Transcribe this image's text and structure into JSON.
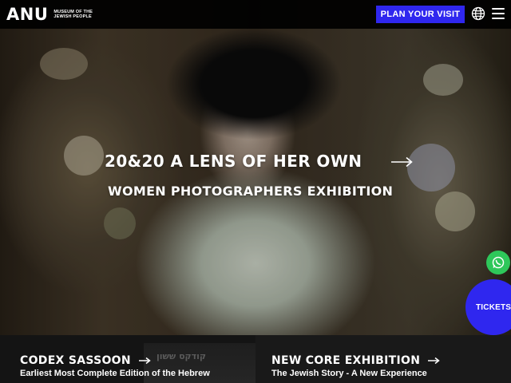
{
  "header": {
    "logo_text": "ANU",
    "logo_subtitle": "Museum of the Jewish People",
    "plan_visit_label": "PLAN YOUR VISIT",
    "language_icon": "globe-icon",
    "menu_icon": "hamburger-menu-icon"
  },
  "hero": {
    "title": "20&20 A LENS OF HER OWN",
    "subtitle": "WOMEN PHOTOGRAPHERS EXHIBITION",
    "arrow_icon": "arrow-right-icon"
  },
  "floating": {
    "whatsapp_icon": "whatsapp-icon",
    "tickets_label": "TICKETS"
  },
  "panels": [
    {
      "title": "CODEX SASSOON",
      "description": "Earliest Most Complete Edition of the Hebrew",
      "background_text": "קודקס ששון"
    },
    {
      "title": "NEW CORE EXHIBITION",
      "description": "The Jewish Story - A New Experience"
    }
  ],
  "colors": {
    "accent_blue": "#2f27ef",
    "whatsapp_green": "#2ec75a",
    "header_bg": "#000000"
  }
}
